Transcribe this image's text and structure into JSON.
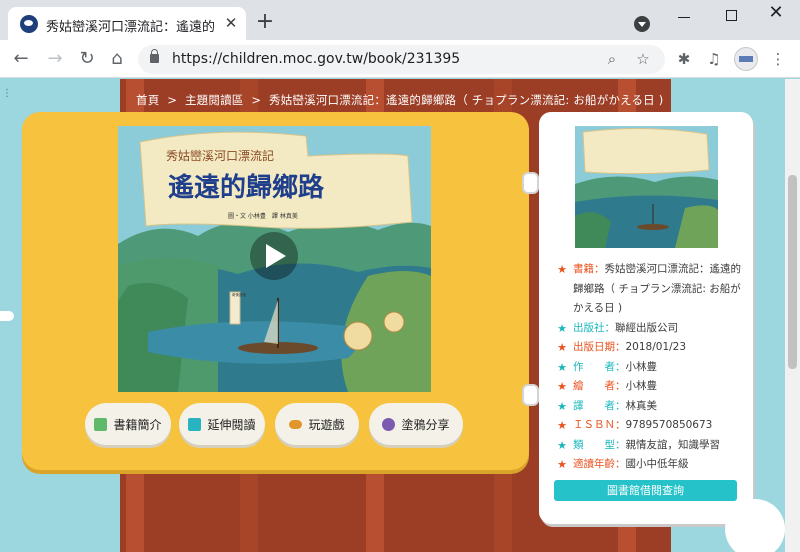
{
  "browser": {
    "tab_title": "秀姑巒溪河口漂流記：遙遠的歸鄉",
    "tab_close": "✕",
    "new_tab": "+",
    "url": "https://children.moc.gov.tw/book/231395",
    "back_glyph": "←",
    "forward_glyph": "→",
    "reload_glyph": "↻",
    "home_glyph": "⌂",
    "zoom_glyph": "⌕",
    "bookmark_glyph": "☆",
    "extensions_glyph": "✱",
    "media_glyph": "♫",
    "menu_glyph": "⋮",
    "close_glyph": "✕"
  },
  "breadcrumb": {
    "items": [
      "首頁",
      ">",
      "主題閱讀區",
      ">",
      "秀姑巒溪河口漂流記：遙遠的歸鄉路（ チョプラン漂流記: お船がかえる日 )"
    ]
  },
  "cover": {
    "series_title": "秀姑巒溪河口漂流記",
    "main_title": "遙遠的歸鄉路",
    "credits": "圖・文 小林豊　譯 林真美",
    "place_label": "奇美部落"
  },
  "actions": [
    {
      "label": "書籍簡介",
      "icon": "book-icon",
      "color": "#5fb96b"
    },
    {
      "label": "延伸閱讀",
      "icon": "reading-icon",
      "color": "#27b3c0"
    },
    {
      "label": "玩遊戲",
      "icon": "game-icon",
      "color": "#e0962a"
    },
    {
      "label": "塗鴉分享",
      "icon": "palette-icon",
      "color": "#7b5bb0"
    }
  ],
  "details": {
    "book_key": "書籍：",
    "book_value": "秀姑巒溪河口漂流記：遙遠的歸鄉路（ チョプラン漂流記: お船がかえる日 )",
    "rows": [
      {
        "key": "出版社：",
        "value": "聯經出版公司",
        "star": "teal"
      },
      {
        "key": "出版日期：",
        "value": "2018/01/23",
        "star": "orange"
      },
      {
        "key": "作　　者：",
        "value": "小林豊",
        "star": "teal"
      },
      {
        "key": "繪　　者：",
        "value": "小林豊",
        "star": "orange"
      },
      {
        "key": "譯　　者：",
        "value": "林真美",
        "star": "teal"
      },
      {
        "key": "ＩＳＢＮ：",
        "value": "9789570850673",
        "star": "orange"
      },
      {
        "key": "類　　型：",
        "value": "親情友誼，知識學習",
        "star": "teal"
      },
      {
        "key": "適讀年齡：",
        "value": "國小中低年級",
        "star": "orange"
      }
    ],
    "lookup_label": "圖書館借閱查詢",
    "star_glyph": "★"
  },
  "colors": {
    "board": "#f7c23e",
    "wall": "#9c3d26",
    "accent": "#26c2c9",
    "star_teal": "#19b7bd",
    "star_orange": "#e8531f"
  }
}
